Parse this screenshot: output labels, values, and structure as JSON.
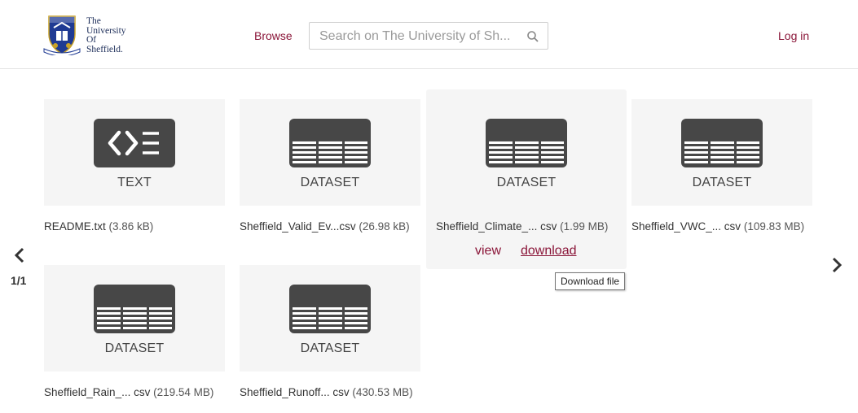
{
  "header": {
    "logo": {
      "line1": "The",
      "line2": "University",
      "line3": "Of",
      "line4": "Sheffield."
    },
    "browse_label": "Browse",
    "search_placeholder": "Search on The University of Sh...",
    "login_label": "Log in"
  },
  "files": [
    {
      "type_label": "TEXT",
      "name": "README.txt",
      "size": "(3.86 kB)",
      "icon": "code-icon"
    },
    {
      "type_label": "DATASET",
      "name": "Sheffield_Valid_Ev...csv",
      "size": "(26.98 kB)",
      "icon": "table-icon"
    },
    {
      "type_label": "DATASET",
      "name": "Sheffield_Climate_... csv",
      "size": "(1.99 MB)",
      "icon": "table-icon"
    },
    {
      "type_label": "DATASET",
      "name": "Sheffield_VWC_... csv",
      "size": "(109.83 MB)",
      "icon": "table-icon"
    },
    {
      "type_label": "DATASET",
      "name": "Sheffield_Rain_... csv",
      "size": "(219.54 MB)",
      "icon": "table-icon"
    },
    {
      "type_label": "DATASET",
      "name": "Sheffield_Runoff... csv",
      "size": "(430.53 MB)",
      "icon": "table-icon"
    }
  ],
  "hover_actions": {
    "view_label": "view",
    "download_label": "download",
    "tooltip": "Download file"
  },
  "pagination": {
    "label": "1/1"
  },
  "colors": {
    "accent": "#8a1538",
    "icon_fill": "#474747",
    "card_bg": "#f5f5f5"
  }
}
